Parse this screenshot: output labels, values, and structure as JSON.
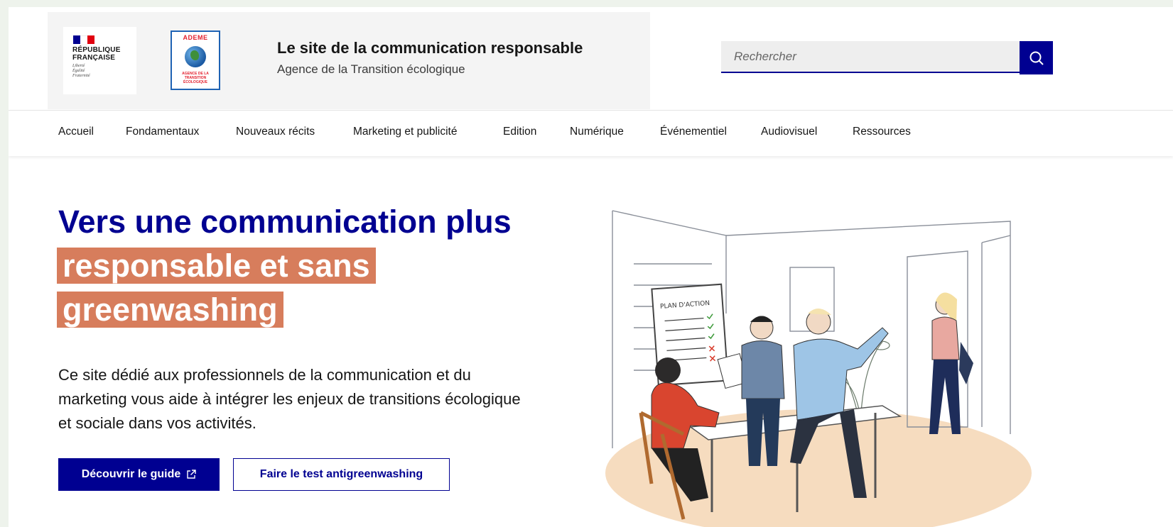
{
  "header": {
    "republic": {
      "name": "RÉPUBLIQUE FRANÇAISE",
      "motto": [
        "Liberté",
        "Égalité",
        "Fraternité"
      ],
      "flag_colors": [
        "#000091",
        "#ffffff",
        "#e1000f"
      ]
    },
    "ademe_logo": {
      "word": "ADEME",
      "subtitle": "AGENCE DE LA TRANSITION ÉCOLOGIQUE"
    },
    "site_title": "Le site de la communication responsable",
    "site_subtitle": "Agence de la Transition écologique",
    "search": {
      "placeholder": "Rechercher",
      "button_icon": "search-icon"
    }
  },
  "nav": {
    "items": [
      {
        "label": "Accueil"
      },
      {
        "label": "Fondamentaux"
      },
      {
        "label": "Nouveaux récits"
      },
      {
        "label": "Marketing et publicité"
      },
      {
        "label": "Edition"
      },
      {
        "label": "Numérique"
      },
      {
        "label": "Événementiel"
      },
      {
        "label": "Audiovisuel"
      },
      {
        "label": "Ressources"
      }
    ]
  },
  "hero": {
    "title_plain": "Vers une communication plus",
    "title_highlight": "responsable et sans greenwashing",
    "description": "Ce site dédié aux professionnels de la communication et du marketing vous aide à intégrer les enjeux de transitions écologique et sociale dans vos activités.",
    "primary_button": "Découvrir le guide",
    "primary_button_icon": "external-link-icon",
    "secondary_button": "Faire le test antigreenwashing",
    "illustration_board_text": "PLAN D'ACTION"
  },
  "colors": {
    "brand_blue": "#000091",
    "highlight": "#d77d5c",
    "page_background": "#eef3ec"
  }
}
